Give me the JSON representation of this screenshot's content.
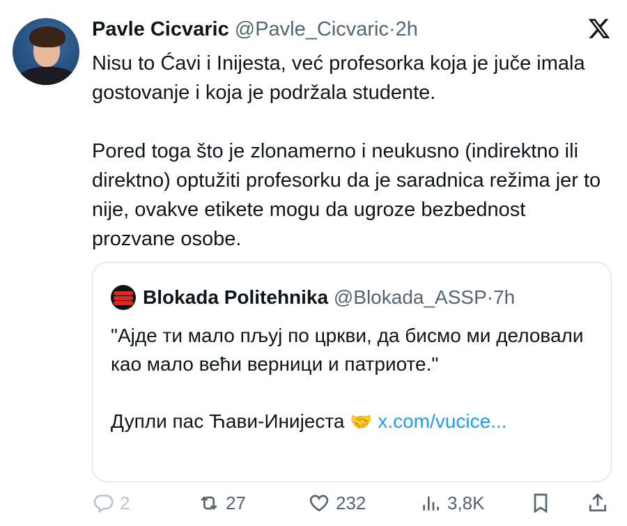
{
  "tweet": {
    "author_name": "Pavle Cicvaric",
    "handle": "@Pavle_Cicvaric",
    "separator": "·",
    "time": "2h",
    "paragraph1": "Nisu to Ćavi i Inijesta, već profesorka koja je juče imala gostovanje i koja je podržala studente.",
    "paragraph2": "Pored toga što je zlonamerno i neukusno (indirektno ili direktno) optužiti profesorku da je saradnica režima jer to nije, ovakve etikete mogu da ugroze bezbednost prozvane osobe."
  },
  "quoted": {
    "author_name": "Blokada Politehnika",
    "handle": "@Blokada_ASSP",
    "separator": "·",
    "time": "7h",
    "paragraph1": "\"Ајде ти мало пљуј по цркви, да бисмо ми деловали као мало већи верници и патриоте.\"",
    "paragraph2": "Дупли пас Ћави-Инијеста",
    "emoji": "🤝",
    "link": "x.com/vucice..."
  },
  "actions": {
    "replies": "2",
    "reposts": "27",
    "likes": "232",
    "views": "3,8K"
  },
  "icons": [
    "x-logo-icon",
    "reply-icon",
    "repost-icon",
    "like-icon",
    "views-icon",
    "bookmark-icon",
    "share-icon"
  ],
  "colors": {
    "text": "#0f1419",
    "secondary": "#536471",
    "link": "#1d9bf0",
    "border": "#cfd9de"
  }
}
